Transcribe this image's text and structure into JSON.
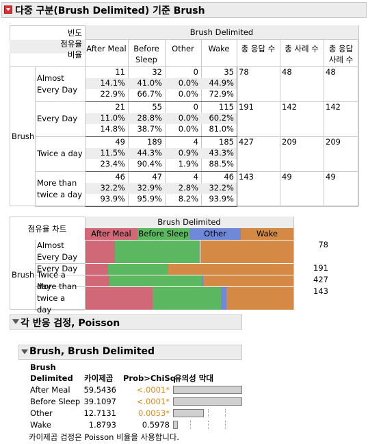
{
  "report": {
    "title": "다중 구분(Brush Delimited) 기준 Brush"
  },
  "crosstab": {
    "stat_labels": [
      "빈도",
      "점유율",
      "비율"
    ],
    "col_group": "Brush Delimited",
    "columns": [
      "After Meal",
      "Before Sleep",
      "Other",
      "Wake"
    ],
    "extra_columns": [
      "총 응답 수",
      "총 사례 수",
      "총 응답 사례 수"
    ],
    "row_group": "Brush",
    "rows": [
      {
        "label": "Almost Every Day",
        "cells": [
          [
            "11",
            "14.1%",
            "22.9%"
          ],
          [
            "32",
            "41.0%",
            "66.7%"
          ],
          [
            "0",
            "0.0%",
            "0.0%"
          ],
          [
            "35",
            "44.9%",
            "72.9%"
          ]
        ],
        "totals": [
          "78",
          "48",
          "48"
        ]
      },
      {
        "label": "Every Day",
        "cells": [
          [
            "21",
            "11.0%",
            "14.8%"
          ],
          [
            "55",
            "28.8%",
            "38.7%"
          ],
          [
            "0",
            "0.0%",
            "0.0%"
          ],
          [
            "115",
            "60.2%",
            "81.0%"
          ]
        ],
        "totals": [
          "191",
          "142",
          "142"
        ]
      },
      {
        "label": "Twice a day",
        "cells": [
          [
            "49",
            "11.5%",
            "23.4%"
          ],
          [
            "189",
            "44.3%",
            "90.4%"
          ],
          [
            "4",
            "0.9%",
            "1.9%"
          ],
          [
            "185",
            "43.3%",
            "88.5%"
          ]
        ],
        "totals": [
          "427",
          "209",
          "209"
        ]
      },
      {
        "label": "More than twice a day",
        "cells": [
          [
            "46",
            "32.2%",
            "93.9%"
          ],
          [
            "47",
            "32.9%",
            "95.9%"
          ],
          [
            "4",
            "2.8%",
            "8.2%"
          ],
          [
            "46",
            "32.2%",
            "93.9%"
          ]
        ],
        "totals": [
          "143",
          "49",
          "49"
        ]
      }
    ]
  },
  "share_chart": {
    "title": "점유율 차트",
    "col_group": "Brush Delimited",
    "row_group": "Brush",
    "legend": [
      {
        "label": "After Meal",
        "color": "#d16878"
      },
      {
        "label": "Before Sleep",
        "color": "#5cb860"
      },
      {
        "label": "Other",
        "color": "#6f88d8"
      },
      {
        "label": "Wake",
        "color": "#d48a44"
      }
    ],
    "rows": [
      {
        "label": "Almost Every Day",
        "total": "78"
      },
      {
        "label": "Every Day",
        "total": "191"
      },
      {
        "label": "Twice a day",
        "total": "427"
      },
      {
        "label": "More than twice a day",
        "total": "143"
      }
    ]
  },
  "chart_data": {
    "type": "bar",
    "stacked": "100%",
    "categories": [
      "Almost Every Day",
      "Every Day",
      "Twice a day",
      "More than twice a day"
    ],
    "series": [
      {
        "name": "After Meal",
        "values": [
          14.1,
          11.0,
          11.5,
          32.2
        ]
      },
      {
        "name": "Before Sleep",
        "values": [
          41.0,
          28.8,
          44.3,
          32.9
        ]
      },
      {
        "name": "Other",
        "values": [
          0.0,
          0.0,
          0.9,
          2.8
        ]
      },
      {
        "name": "Wake",
        "values": [
          44.9,
          60.2,
          43.3,
          32.2
        ]
      }
    ]
  },
  "poisson": {
    "title": "각 반응 검정, Poisson",
    "sub_title": "Brush, Brush Delimited",
    "headers": {
      "col1_line1": "Brush",
      "col1_line2": "Delimited",
      "chisq": "카이제곱",
      "prob": "Prob>ChiSq",
      "bar": "유의성 막대"
    },
    "rows": [
      {
        "label": "After Meal",
        "chisq": "59.5436",
        "prob": "<.0001*",
        "significant": true,
        "bar_fraction": 1.0
      },
      {
        "label": "Before Sleep",
        "chisq": "39.1097",
        "prob": "<.0001*",
        "significant": true,
        "bar_fraction": 1.0
      },
      {
        "label": "Other",
        "chisq": "12.7131",
        "prob": "0.0053*",
        "significant": true,
        "bar_fraction": 0.45
      },
      {
        "label": "Wake",
        "chisq": "1.8793",
        "prob": "0.5978",
        "significant": false,
        "bar_fraction": 0.07
      }
    ],
    "footnote": "카이제곱 검정은 Poisson 비율을 사용합니다."
  }
}
